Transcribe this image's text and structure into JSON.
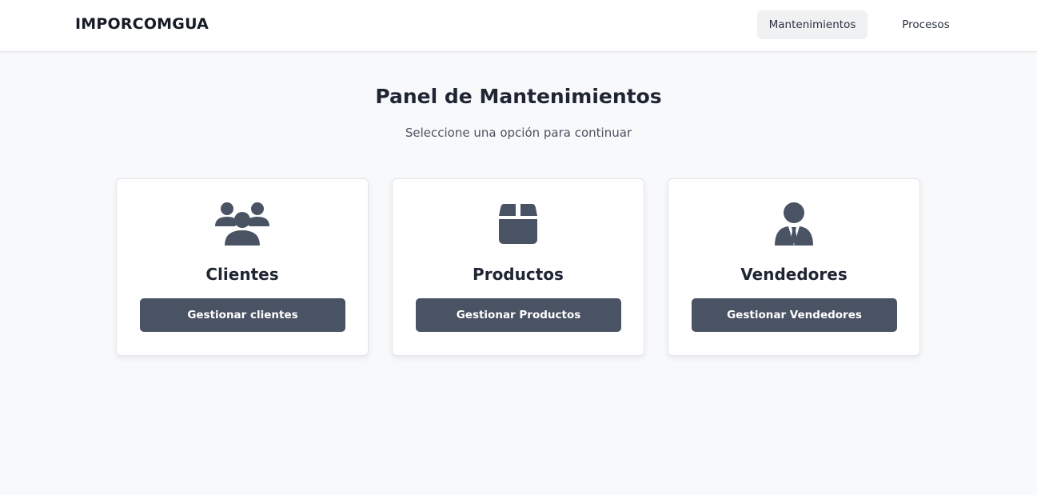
{
  "brand": "IMPORCOMGUA",
  "nav": {
    "mantenimientos": "Mantenimientos",
    "procesos": "Procesos"
  },
  "page": {
    "title": "Panel de Mantenimientos",
    "subtitle": "Seleccione una opción para continuar"
  },
  "cards": [
    {
      "icon": "users-group-icon",
      "title": "Clientes",
      "button": "Gestionar clientes"
    },
    {
      "icon": "box-icon",
      "title": "Productos",
      "button": "Gestionar Productos"
    },
    {
      "icon": "user-tie-icon",
      "title": "Vendedores",
      "button": "Gestionar Vendedores"
    }
  ],
  "colors": {
    "icon": "#4a5363",
    "button": "#4a5363",
    "background": "#f8f9fb"
  }
}
